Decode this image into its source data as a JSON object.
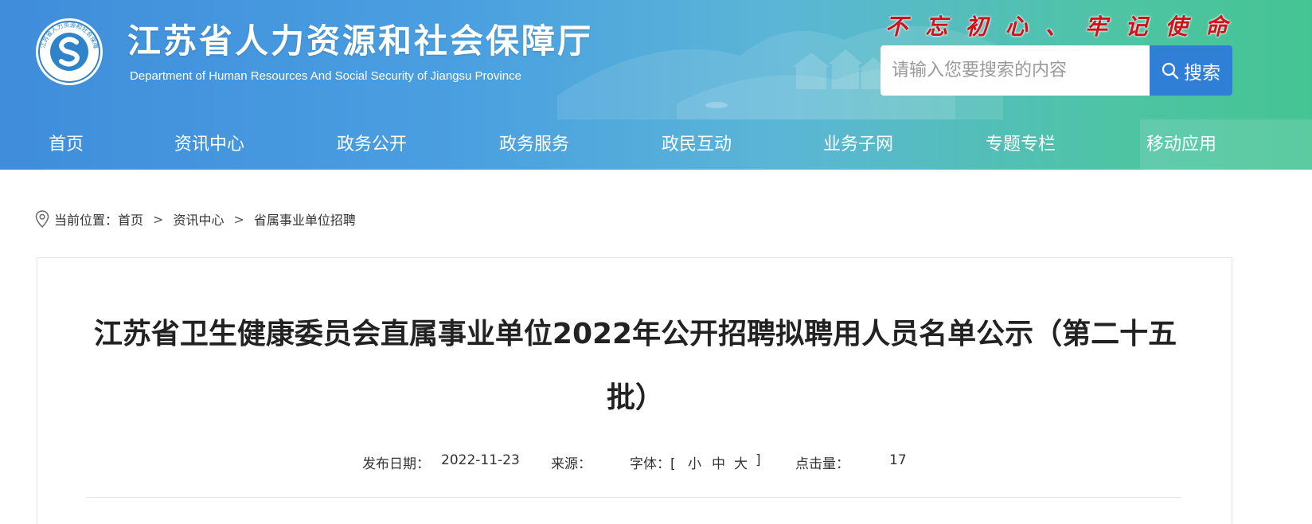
{
  "header": {
    "site_title": "江苏省人力资源和社会保障厅",
    "site_subtitle": "Department of Human Resources And Social Security of Jiangsu Province",
    "slogan": [
      "不",
      "忘",
      "初",
      "心",
      "、",
      "牢",
      "记",
      "使",
      "命"
    ],
    "logo_text": "江苏省人力资源和社会保障厅",
    "search": {
      "placeholder": "请输入您要搜索的内容",
      "button_label": "搜索"
    },
    "nav": [
      "首页",
      "资讯中心",
      "政务公开",
      "政务服务",
      "政民互动",
      "业务子网",
      "专题专栏",
      "移动应用"
    ],
    "colors": {
      "gradient_start": "#3f8ddb",
      "gradient_end": "#45c493",
      "slogan": "#d1121b",
      "search_button": "#2f7fd7"
    }
  },
  "breadcrumb": {
    "prefix": "当前位置：",
    "items": [
      "首页",
      "资讯中心",
      "省属事业单位招聘"
    ],
    "separator": ">"
  },
  "article": {
    "title": "江苏省卫生健康委员会直属事业单位2022年公开招聘拟聘用人员名单公示（第二十五批）",
    "meta": {
      "date_label": "发布日期：",
      "date_value": "2022-11-23",
      "source_label": "来源：",
      "source_value": "",
      "font_label": "字体：[",
      "font_small": "小",
      "font_medium": "中",
      "font_large": "大",
      "font_close": "]",
      "views_label": "点击量：",
      "views_value": "17"
    }
  }
}
